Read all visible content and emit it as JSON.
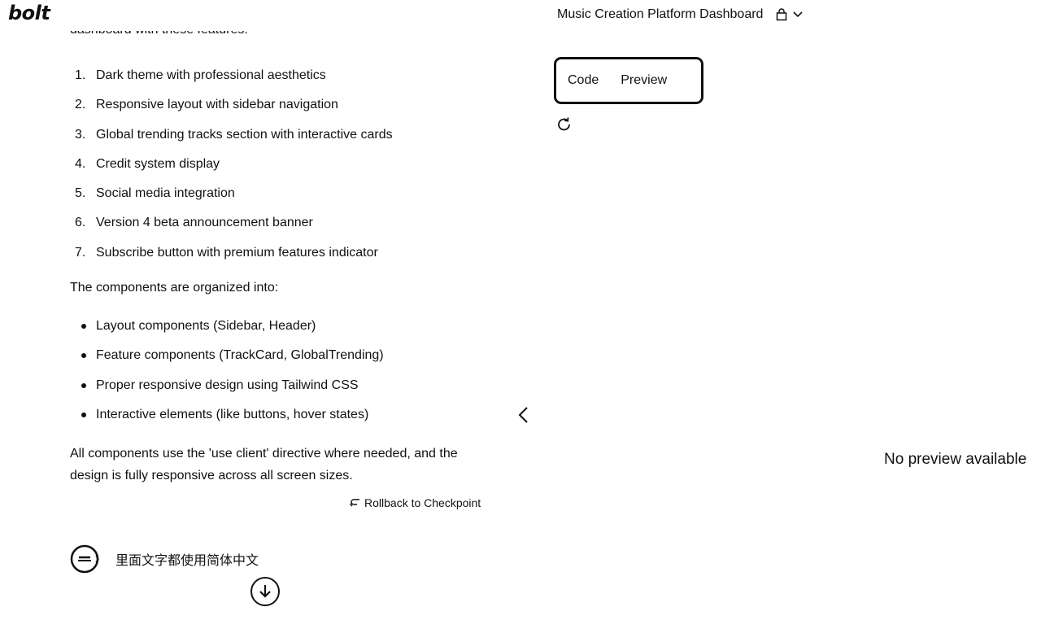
{
  "app": {
    "logo": "bolt"
  },
  "header": {
    "project_title": "Music Creation Platform Dashboard"
  },
  "chat": {
    "cut_line": "dashboard with these features:",
    "features": [
      {
        "num": "1.",
        "text": "Dark theme with professional aesthetics"
      },
      {
        "num": "2.",
        "text": "Responsive layout with sidebar navigation"
      },
      {
        "num": "3.",
        "text": "Global trending tracks section with interactive cards"
      },
      {
        "num": "4.",
        "text": "Credit system display"
      },
      {
        "num": "5.",
        "text": "Social media integration"
      },
      {
        "num": "6.",
        "text": "Version 4 beta announcement banner"
      },
      {
        "num": "7.",
        "text": "Subscribe button with premium features indicator"
      }
    ],
    "components_intro": "The components are organized into:",
    "components": [
      "Layout components (Sidebar, Header)",
      "Feature components (TrackCard, GlobalTrending)",
      "Proper responsive design using Tailwind CSS",
      "Interactive elements (like buttons, hover states)"
    ],
    "closing": "All components use the 'use client' directive where needed, and the design is fully responsive across all screen sizes.",
    "rollback_label": "Rollback to Checkpoint",
    "user_message": "里面文字都使用简体中文"
  },
  "workbench": {
    "tabs": [
      "Code",
      "Preview"
    ],
    "empty_state": "No preview available"
  }
}
